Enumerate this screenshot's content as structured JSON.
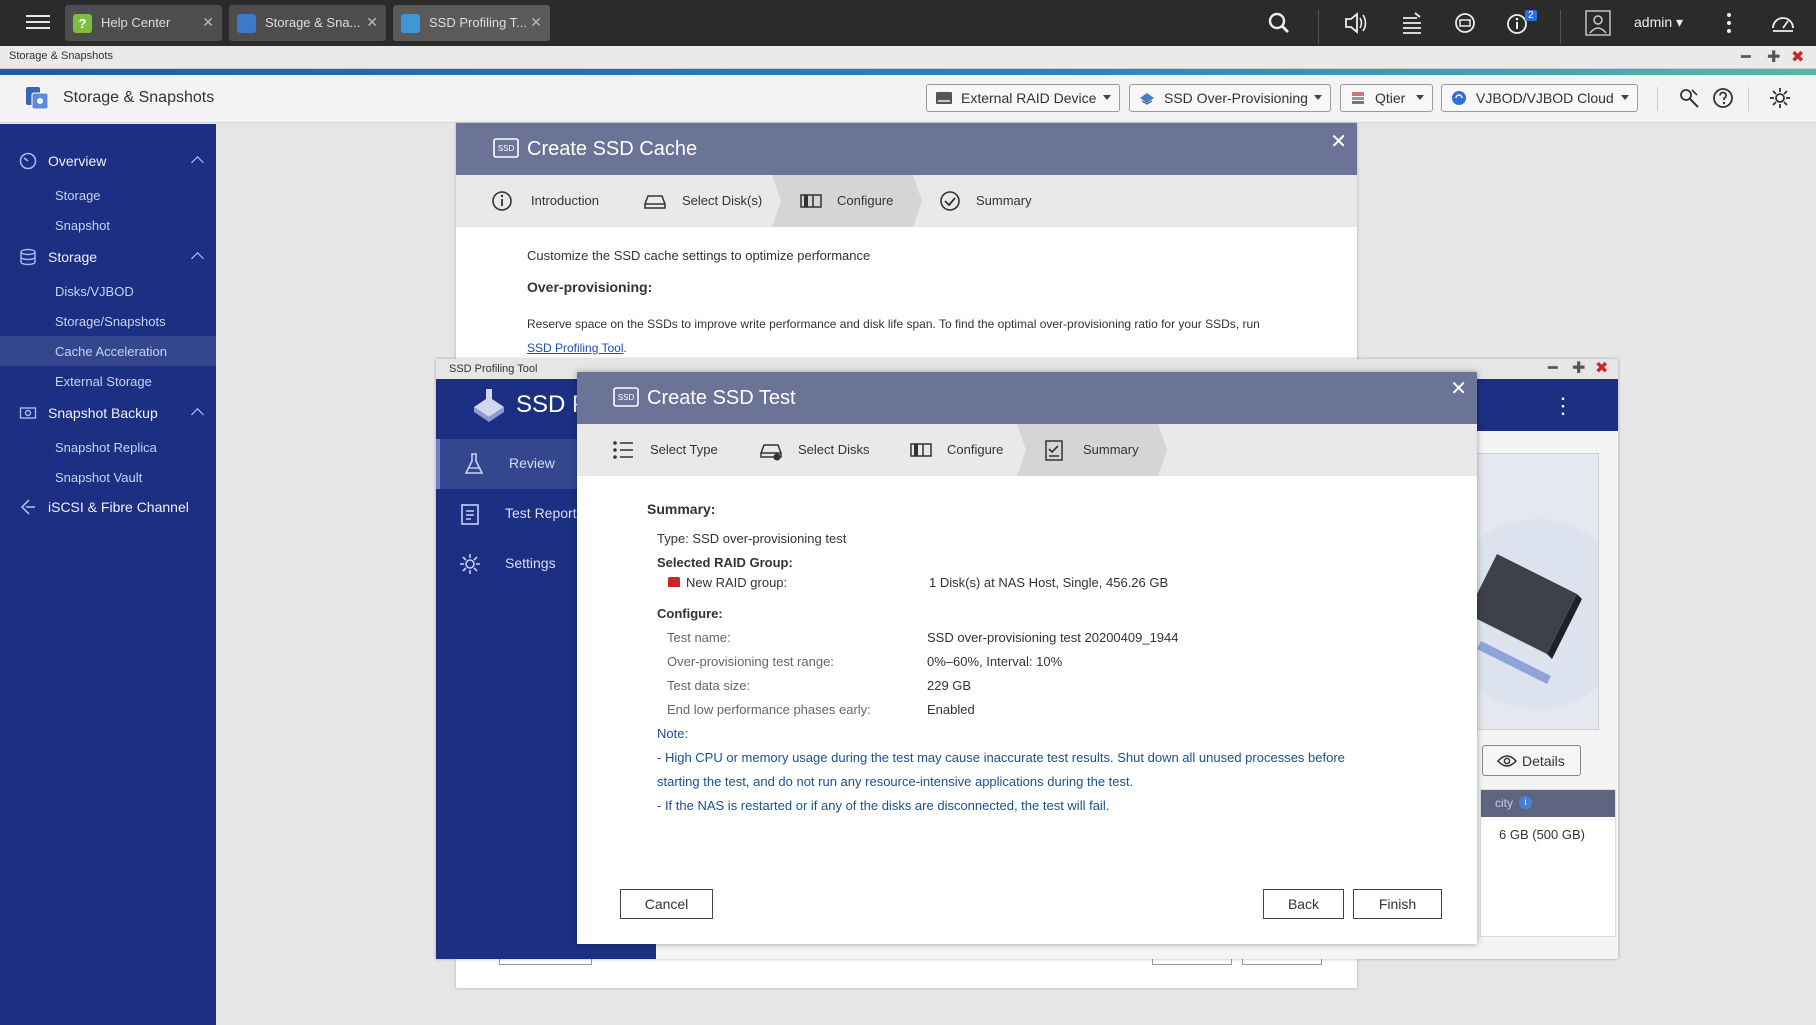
{
  "taskbar": {
    "tabs": [
      {
        "label": "Help Center"
      },
      {
        "label": "Storage & Sna..."
      },
      {
        "label": "SSD Profiling T..."
      }
    ],
    "notification_count": "2",
    "user": "admin"
  },
  "window": {
    "title": "Storage & Snapshots"
  },
  "app": {
    "title": "Storage & Snapshots",
    "header_buttons": [
      {
        "label": "External RAID Device"
      },
      {
        "label": "SSD Over-Provisioning"
      },
      {
        "label": "Qtier"
      },
      {
        "label": "VJBOD/VJBOD Cloud"
      }
    ]
  },
  "sidebar": {
    "sections": [
      {
        "label": "Overview",
        "items": [
          "Storage",
          "Snapshot"
        ]
      },
      {
        "label": "Storage",
        "items": [
          "Disks/VJBOD",
          "Storage/Snapshots",
          "Cache Acceleration",
          "External Storage"
        ]
      },
      {
        "label": "Snapshot Backup",
        "items": [
          "Snapshot Replica",
          "Snapshot Vault"
        ]
      },
      {
        "label": "iSCSI & Fibre Channel",
        "items": []
      }
    ],
    "active_item": "Cache Acceleration"
  },
  "cache_dialog": {
    "icon_text": "SSD",
    "title": "Create SSD Cache",
    "steps": [
      "Introduction",
      "Select Disk(s)",
      "Configure",
      "Summary"
    ],
    "intro": "Customize the SSD cache settings to optimize performance",
    "heading": "Over-provisioning:",
    "desc": "Reserve space on the SSDs to improve write performance and disk life span. To find the optimal over-provisioning ratio for your SSDs, run",
    "link": "SSD Profiling Tool",
    "link_suffix": "."
  },
  "profiling_window": {
    "title": "SSD Profiling Tool",
    "header_title": "SSD P",
    "nav": [
      "Review",
      "Test Report",
      "Settings"
    ],
    "details_label": "Details",
    "table_header": "city",
    "table_cell": "6 GB (500 GB)"
  },
  "test_dialog": {
    "icon_text": "SSD",
    "title": "Create SSD Test",
    "steps": [
      "Select Type",
      "Select Disks",
      "Configure",
      "Summary"
    ],
    "summary_heading": "Summary:",
    "type_line": "Type: SSD over-provisioning test",
    "raid_heading": "Selected RAID Group:",
    "raid_label": "New RAID group:",
    "raid_value": "1 Disk(s) at NAS Host, Single, 456.26 GB",
    "configure_heading": "Configure:",
    "config": [
      {
        "label": "Test name:",
        "value": "SSD over-provisioning test 20200409_1944"
      },
      {
        "label": "Over-provisioning test range:",
        "value": "0%–60%, Interval: 10%"
      },
      {
        "label": "Test data size:",
        "value": "229 GB"
      },
      {
        "label": "End low performance phases early:",
        "value": "Enabled"
      }
    ],
    "note_heading": "Note:",
    "note_lines": [
      "- High CPU or memory usage during the test may cause inaccurate test results. Shut down all unused processes before",
      "starting the test, and do not run any resource-intensive applications during the test.",
      "- If the NAS is restarted or if any of the disks are disconnected, the test will fail."
    ],
    "buttons": {
      "cancel": "Cancel",
      "back": "Back",
      "finish": "Finish"
    }
  },
  "colors": {
    "sidebar": "#1c2f82",
    "dialog_header": "#6b7496",
    "taskbar": "#2b2b2b",
    "link": "#1a4fb8",
    "note": "#1f4f8c"
  }
}
